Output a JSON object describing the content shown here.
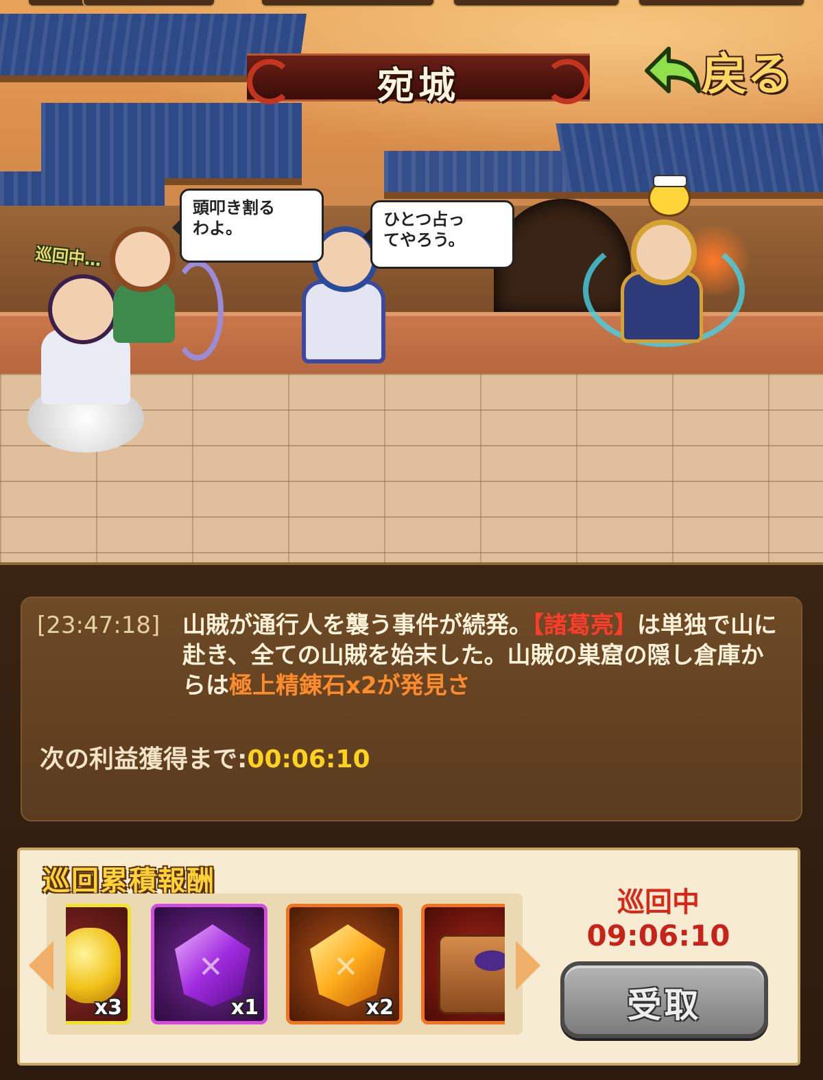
{
  "header": {
    "location_title": "宛城",
    "back_label": "戻る"
  },
  "scene": {
    "speech_1": "頭叩き割る\nわよ。",
    "speech_2": "ひとつ占っ\nてやろう。",
    "patrol_tag": "巡回中…"
  },
  "log": {
    "timestamp": "[23:47:18]",
    "text_part1": "山賊が通行人を襲う事件が続発。",
    "hero_name": "【諸葛亮】",
    "text_part2": "は単独で山に赴き、全ての山賊を始末した。山賊の巣窟の隠し倉庫からは",
    "reward_text": "極上精錬石x2が発見さ"
  },
  "next_reward": {
    "label": "次の利益獲得まで:",
    "time": "00:06:10"
  },
  "rewards": {
    "title": "巡回累積報酬",
    "items": [
      {
        "icon": "gold-ingot-icon",
        "qty": "x3"
      },
      {
        "icon": "purple-gem-icon",
        "qty": "x1"
      },
      {
        "icon": "orange-gem-icon",
        "qty": "x2"
      },
      {
        "icon": "treasure-chest-icon",
        "qty": ""
      }
    ]
  },
  "status": {
    "label": "巡回中",
    "timer": "09:06:10",
    "claim_label": "受取"
  },
  "colors": {
    "hero_name": "#ff3b2a",
    "reward_highlight": "#ff8c2a",
    "timer": "#ffd21e",
    "status": "#d8281a"
  }
}
